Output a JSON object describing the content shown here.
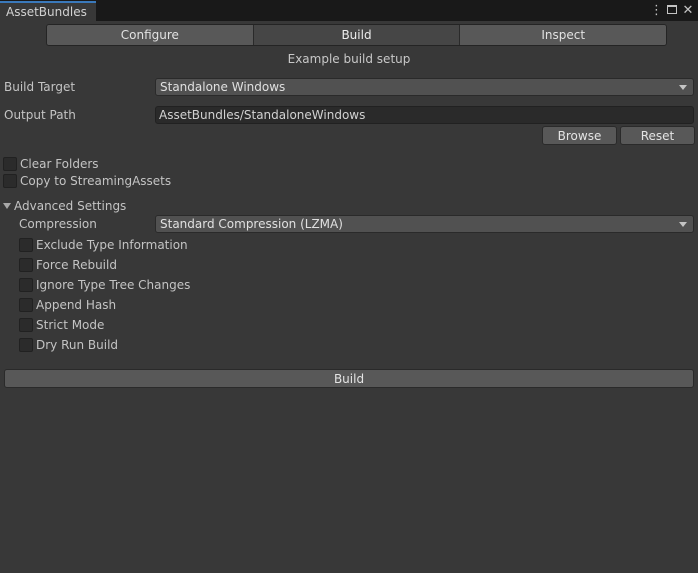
{
  "window": {
    "tab_title": "AssetBundles"
  },
  "toolbar": {
    "tabs": [
      "Configure",
      "Build",
      "Inspect"
    ],
    "active_tab": "Build"
  },
  "subtitle": "Example build setup",
  "build_target": {
    "label": "Build Target",
    "value": "Standalone Windows"
  },
  "output_path": {
    "label": "Output Path",
    "value": "AssetBundles/StandaloneWindows",
    "browse_label": "Browse",
    "reset_label": "Reset"
  },
  "options": [
    {
      "label": "Clear Folders",
      "checked": false
    },
    {
      "label": "Copy to StreamingAssets",
      "checked": false
    }
  ],
  "advanced": {
    "label": "Advanced Settings",
    "expanded": true,
    "compression": {
      "label": "Compression",
      "value": "Standard Compression (LZMA)"
    },
    "checkboxes": [
      {
        "label": "Exclude Type Information",
        "checked": false
      },
      {
        "label": "Force Rebuild",
        "checked": false
      },
      {
        "label": "Ignore Type Tree Changes",
        "checked": false
      },
      {
        "label": "Append Hash",
        "checked": false
      },
      {
        "label": "Strict Mode",
        "checked": false
      },
      {
        "label": "Dry Run Build",
        "checked": false
      }
    ]
  },
  "build_button": "Build",
  "icons": {
    "menu": "kebab-menu-icon",
    "maximize": "maximize-icon",
    "close": "close-icon"
  },
  "colors": {
    "background": "#383838",
    "titlebar": "#191919",
    "tab_accent": "#3a79bb",
    "button": "#585858",
    "field": "#2a2a2a"
  }
}
